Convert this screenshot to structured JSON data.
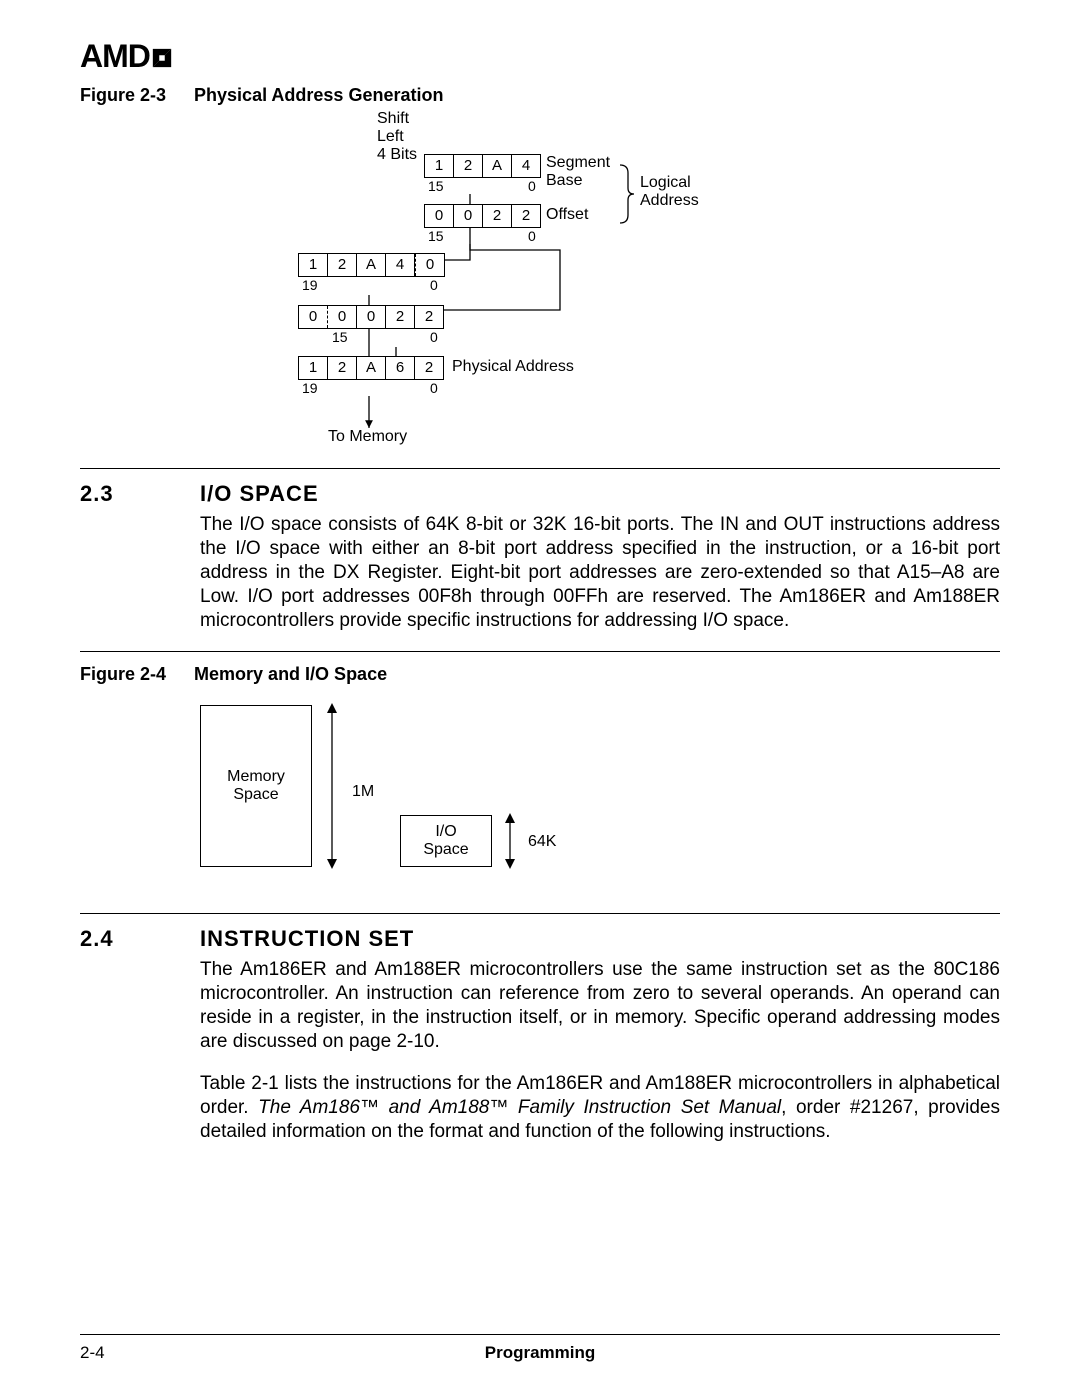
{
  "logo": "AMD",
  "figure3": {
    "caption_num": "Figure 2-3",
    "caption_title": "Physical Address Generation",
    "shift_label_l1": "Shift",
    "shift_label_l2": "Left",
    "shift_label_l3": "4 Bits",
    "segment_cells": [
      "1",
      "2",
      "A",
      "4"
    ],
    "segment_hi": "15",
    "segment_lo": "0",
    "segment_label_l1": "Segment",
    "segment_label_l2": "Base",
    "offset_cells": [
      "0",
      "0",
      "2",
      "2"
    ],
    "offset_hi": "15",
    "offset_lo": "0",
    "offset_label": "Offset",
    "logical_l1": "Logical",
    "logical_l2": "Address",
    "shifted_cells": [
      "1",
      "2",
      "A",
      "4",
      "0"
    ],
    "shifted_hi": "19",
    "shifted_lo": "0",
    "ext_cells": [
      "0",
      "0",
      "0",
      "2",
      "2"
    ],
    "ext_hi": "15",
    "ext_lo": "0",
    "phys_cells": [
      "1",
      "2",
      "A",
      "6",
      "2"
    ],
    "phys_hi": "19",
    "phys_lo": "0",
    "phys_label": "Physical Address",
    "to_memory": "To Memory"
  },
  "section23": {
    "num": "2.3",
    "title": "I/O SPACE",
    "body": "The I/O space consists of 64K 8-bit or 32K 16-bit ports. The IN and OUT instructions address the I/O space with either an 8-bit port address specified in the instruction, or a 16-bit port address in the DX Register. Eight-bit port addresses are zero-extended so that A15–A8 are Low. I/O port addresses 00F8h through 00FFh are reserved. The Am186ER and Am188ER microcontrollers provide specific instructions for addressing I/O space."
  },
  "figure4": {
    "caption_num": "Figure 2-4",
    "caption_title": "Memory and I/O Space",
    "mem_l1": "Memory",
    "mem_l2": "Space",
    "mem_size": "1M",
    "io_l1": "I/O",
    "io_l2": "Space",
    "io_size": "64K"
  },
  "section24": {
    "num": "2.4",
    "title": "INSTRUCTION SET",
    "body1": "The Am186ER and Am188ER microcontrollers use the same instruction set as the 80C186 microcontroller. An instruction can reference from zero to several operands. An operand can reside in a register, in the instruction itself, or in memory. Specific operand addressing modes are discussed on page 2-10.",
    "body2a": "Table 2-1 lists the instructions for the Am186ER and Am188ER microcontrollers in alphabetical order. ",
    "body2b_ital": "The Am186™ and Am188™ Family Instruction Set Manual",
    "body2c": ", order #21267, provides detailed information on the format and function of the following instructions."
  },
  "footer": {
    "page": "2-4",
    "title": "Programming"
  }
}
